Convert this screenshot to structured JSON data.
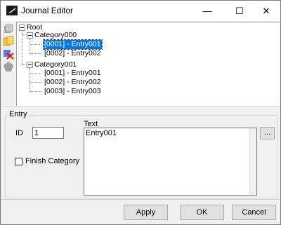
{
  "window": {
    "title": "Journal Editor"
  },
  "titlebar": {
    "minimize": "—",
    "maximize": "☐",
    "close": "✕"
  },
  "tree": {
    "root": "Root",
    "categories": [
      {
        "label": "Category000",
        "entries": [
          "[0001] - Entry001",
          "[0002] - Entry002"
        ]
      },
      {
        "label": "Category001",
        "entries": [
          "[0001] - Entry001",
          "[0002] - Entry002",
          "[0003] - Entry003"
        ]
      }
    ],
    "selected": "[0001] - Entry001"
  },
  "entry": {
    "group_label": "Entry",
    "id_label": "ID",
    "id_value": "1",
    "text_label": "Text",
    "text_value": "Entry001",
    "browse_label": "...",
    "finish_category_label": "Finish Category",
    "finish_category_checked": false
  },
  "buttons": {
    "apply": "Apply",
    "ok": "OK",
    "cancel": "Cancel"
  },
  "colors": {
    "selection": "#0078d7",
    "window_bg": "#f0f0f0"
  }
}
